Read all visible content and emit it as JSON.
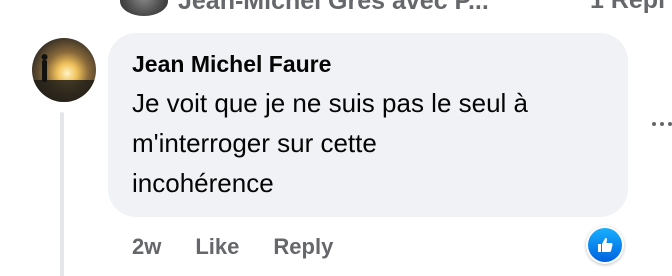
{
  "previous_reply": {
    "summary_text": "Jean-Michel Gres avec P...",
    "count_text": "1 Repl"
  },
  "comment": {
    "author": "Jean Michel Faure",
    "text": "Je voit que je ne suis pas le seul à\nm'interroger sur cette\nincohérence",
    "time": "2w",
    "like_label": "Like",
    "reply_label": "Reply",
    "reaction_icon": "like-thumbs-up-icon"
  },
  "colors": {
    "bubble_bg": "#f0f2f5",
    "secondary_text": "#65676b",
    "primary_text": "#050505",
    "like_blue": "#0866ff"
  }
}
